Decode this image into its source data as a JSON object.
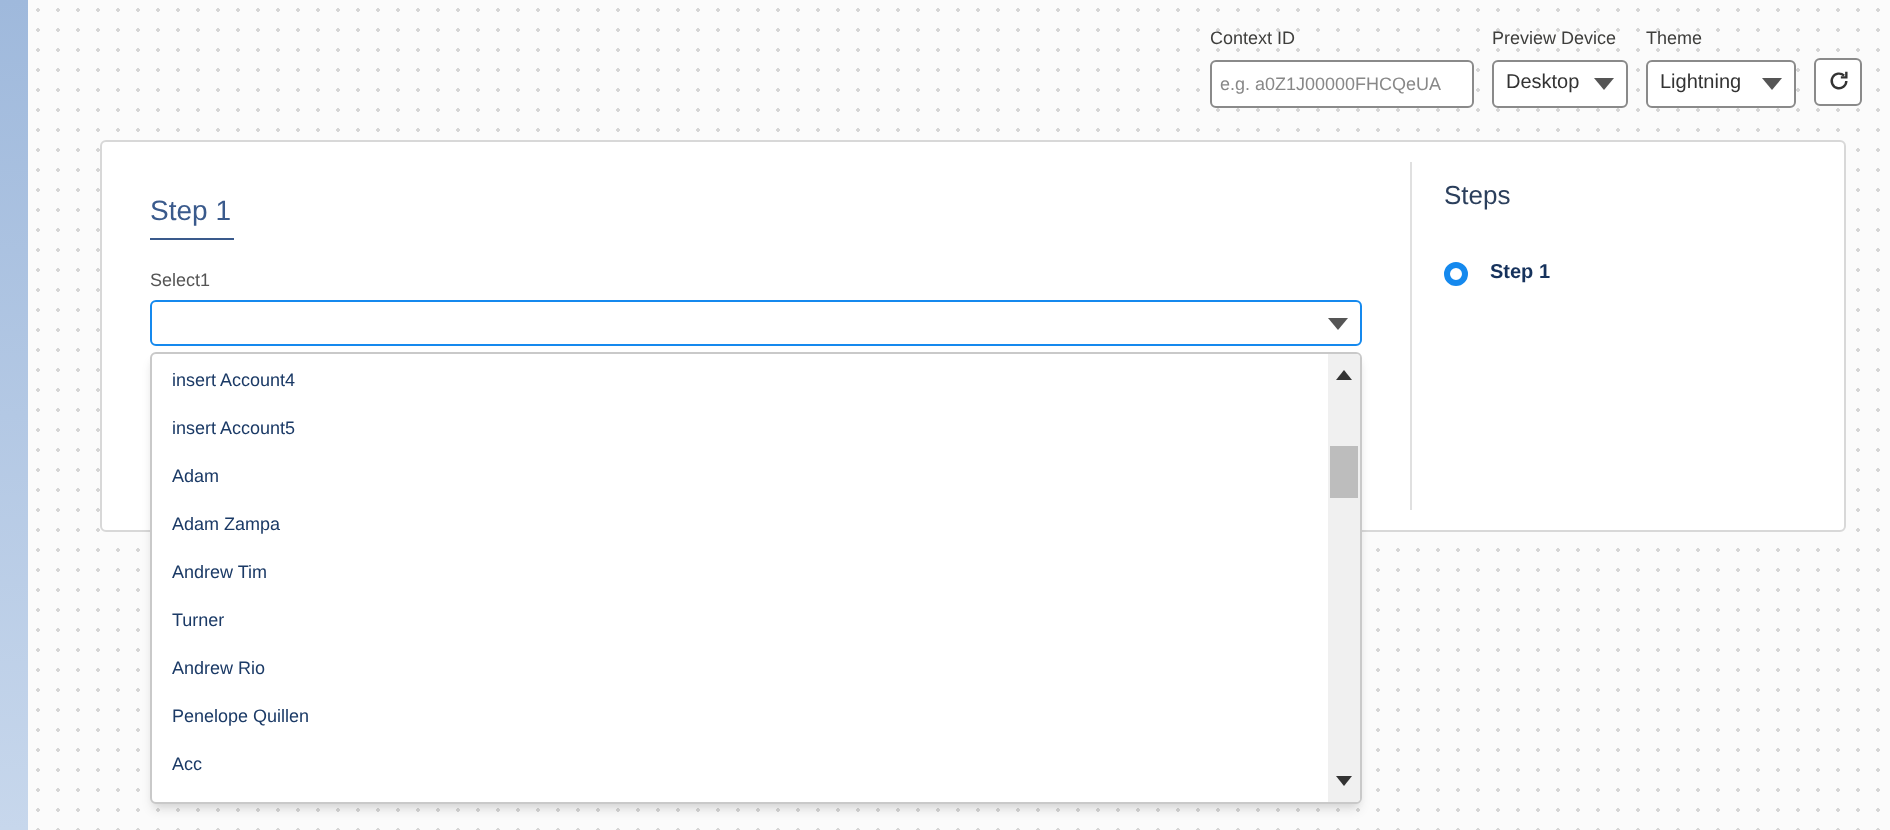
{
  "toolbar": {
    "context_id": {
      "label": "Context ID",
      "placeholder": "e.g. a0Z1J00000FHCQeUA"
    },
    "preview_device": {
      "label": "Preview Device",
      "value": "Desktop"
    },
    "theme": {
      "label": "Theme",
      "value": "Lightning"
    }
  },
  "form": {
    "step_title": "Step 1",
    "select": {
      "label": "Select1",
      "expanded": true,
      "options": [
        "insert Account4",
        "insert Account5",
        "Adam",
        "Adam Zampa",
        "Andrew Tim",
        "Turner",
        "Andrew Rio",
        "Penelope Quillen",
        "Acc"
      ]
    }
  },
  "steps": {
    "title": "Steps",
    "items": [
      {
        "label": "Step 1",
        "selected": true
      }
    ]
  }
}
